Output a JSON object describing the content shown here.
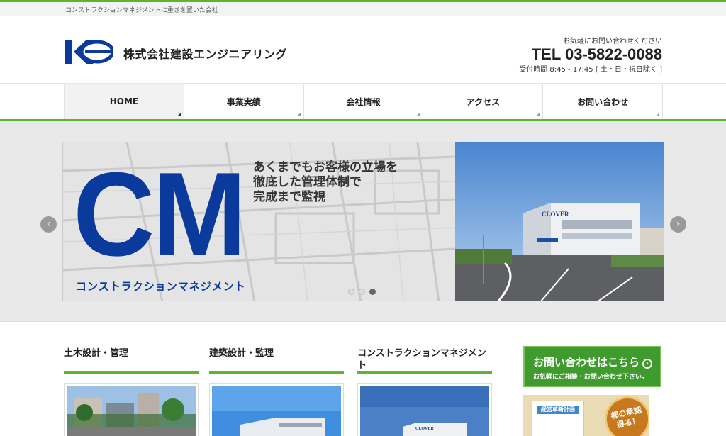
{
  "topbar": {
    "tagline": "コンストラクションマネジメントに重きを置いた会社"
  },
  "header": {
    "company_name": "株式会社建設エンジニアリング",
    "contact_note": "お気軽にお問い合わせください",
    "tel": "TEL 03-5822-0088",
    "hours": "受付時間 8:45 - 17:45 [ 土・日・祝日除く ]"
  },
  "nav": {
    "items": [
      {
        "label": "HOME",
        "active": true
      },
      {
        "label": "事業実績",
        "active": false
      },
      {
        "label": "会社情報",
        "active": false
      },
      {
        "label": "アクセス",
        "active": false
      },
      {
        "label": "お問い合わせ",
        "active": false
      }
    ]
  },
  "slider": {
    "cm_text": "CM",
    "slogan_lines": [
      "あくまでもお客様の立場を",
      "徹底した管理体制で",
      "完成まで監視"
    ],
    "caption": "コンストラクションマネジメント",
    "building_sign": "CLOVER",
    "slide_count": 3,
    "current_slide": 3,
    "prev_icon": "chevron-left-icon",
    "next_icon": "chevron-right-icon"
  },
  "sections": [
    {
      "title": "土木設計・管理"
    },
    {
      "title": "建築設計・監理"
    },
    {
      "title": "コンストラクションマネジメント"
    }
  ],
  "sidebar": {
    "contact_banner_title": "お問い合わせはこちら",
    "contact_banner_sub": "お気軽にご相談・お問い合わせ下さい。",
    "ad_plan_label": "経営革新計画",
    "ad_seal": "都の承認得る！"
  },
  "colors": {
    "accent_green": "#5cb531",
    "brand_blue": "#0a3a9c",
    "banner_green": "#3f9b2e"
  }
}
